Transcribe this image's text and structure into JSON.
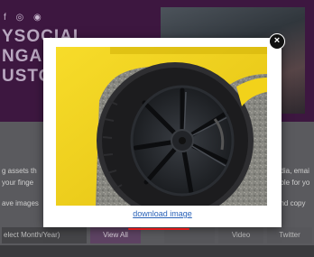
{
  "background": {
    "social_icons": "f ◎ ◉",
    "title_lines": [
      "YSOCIAL",
      "NGAG",
      "USTO"
    ],
    "left_lines": [
      "g assets th",
      "your finge",
      "ave images"
    ],
    "right_lines": [
      "edia, emai",
      "able for yo",
      "and copy"
    ],
    "select_text": "elect Month/Year)",
    "view_all_label": "View All",
    "grey_tabs": [
      "",
      "Video",
      "Twitter"
    ]
  },
  "modal": {
    "image_alt": "Close-up of a yellow car's rear tire and black multi-spoke wheel",
    "download_label": "download image",
    "close_label": "×"
  },
  "colors": {
    "link": "#2a62b8",
    "highlight": "#e01a1a",
    "car_body": "#f2d21a"
  }
}
